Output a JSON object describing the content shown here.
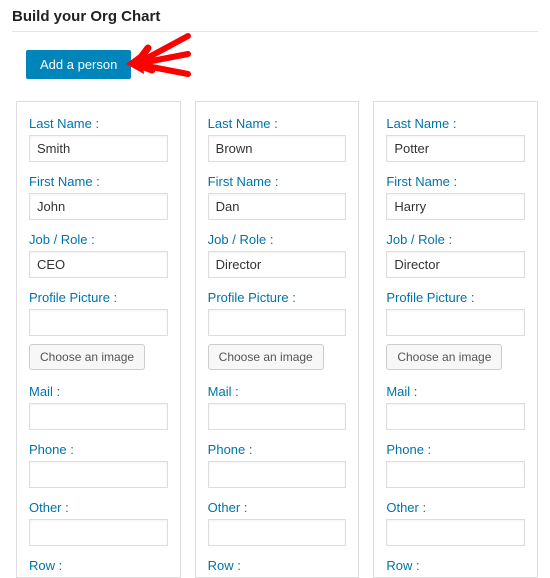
{
  "title": "Build your Org Chart",
  "addButton": "Add a person",
  "labels": {
    "lastName": "Last Name :",
    "firstName": "First Name :",
    "jobRole": "Job / Role :",
    "profilePicture": "Profile Picture :",
    "chooseImage": "Choose an image",
    "mail": "Mail :",
    "phone": "Phone :",
    "other": "Other :",
    "row": "Row :"
  },
  "people": [
    {
      "lastName": "Smith",
      "firstName": "John",
      "jobRole": "CEO",
      "profilePicture": "",
      "mail": "",
      "phone": "",
      "other": ""
    },
    {
      "lastName": "Brown",
      "firstName": "Dan",
      "jobRole": "Director",
      "profilePicture": "",
      "mail": "",
      "phone": "",
      "other": ""
    },
    {
      "lastName": "Potter",
      "firstName": "Harry",
      "jobRole": "Director",
      "profilePicture": "",
      "mail": "",
      "phone": "",
      "other": ""
    }
  ]
}
